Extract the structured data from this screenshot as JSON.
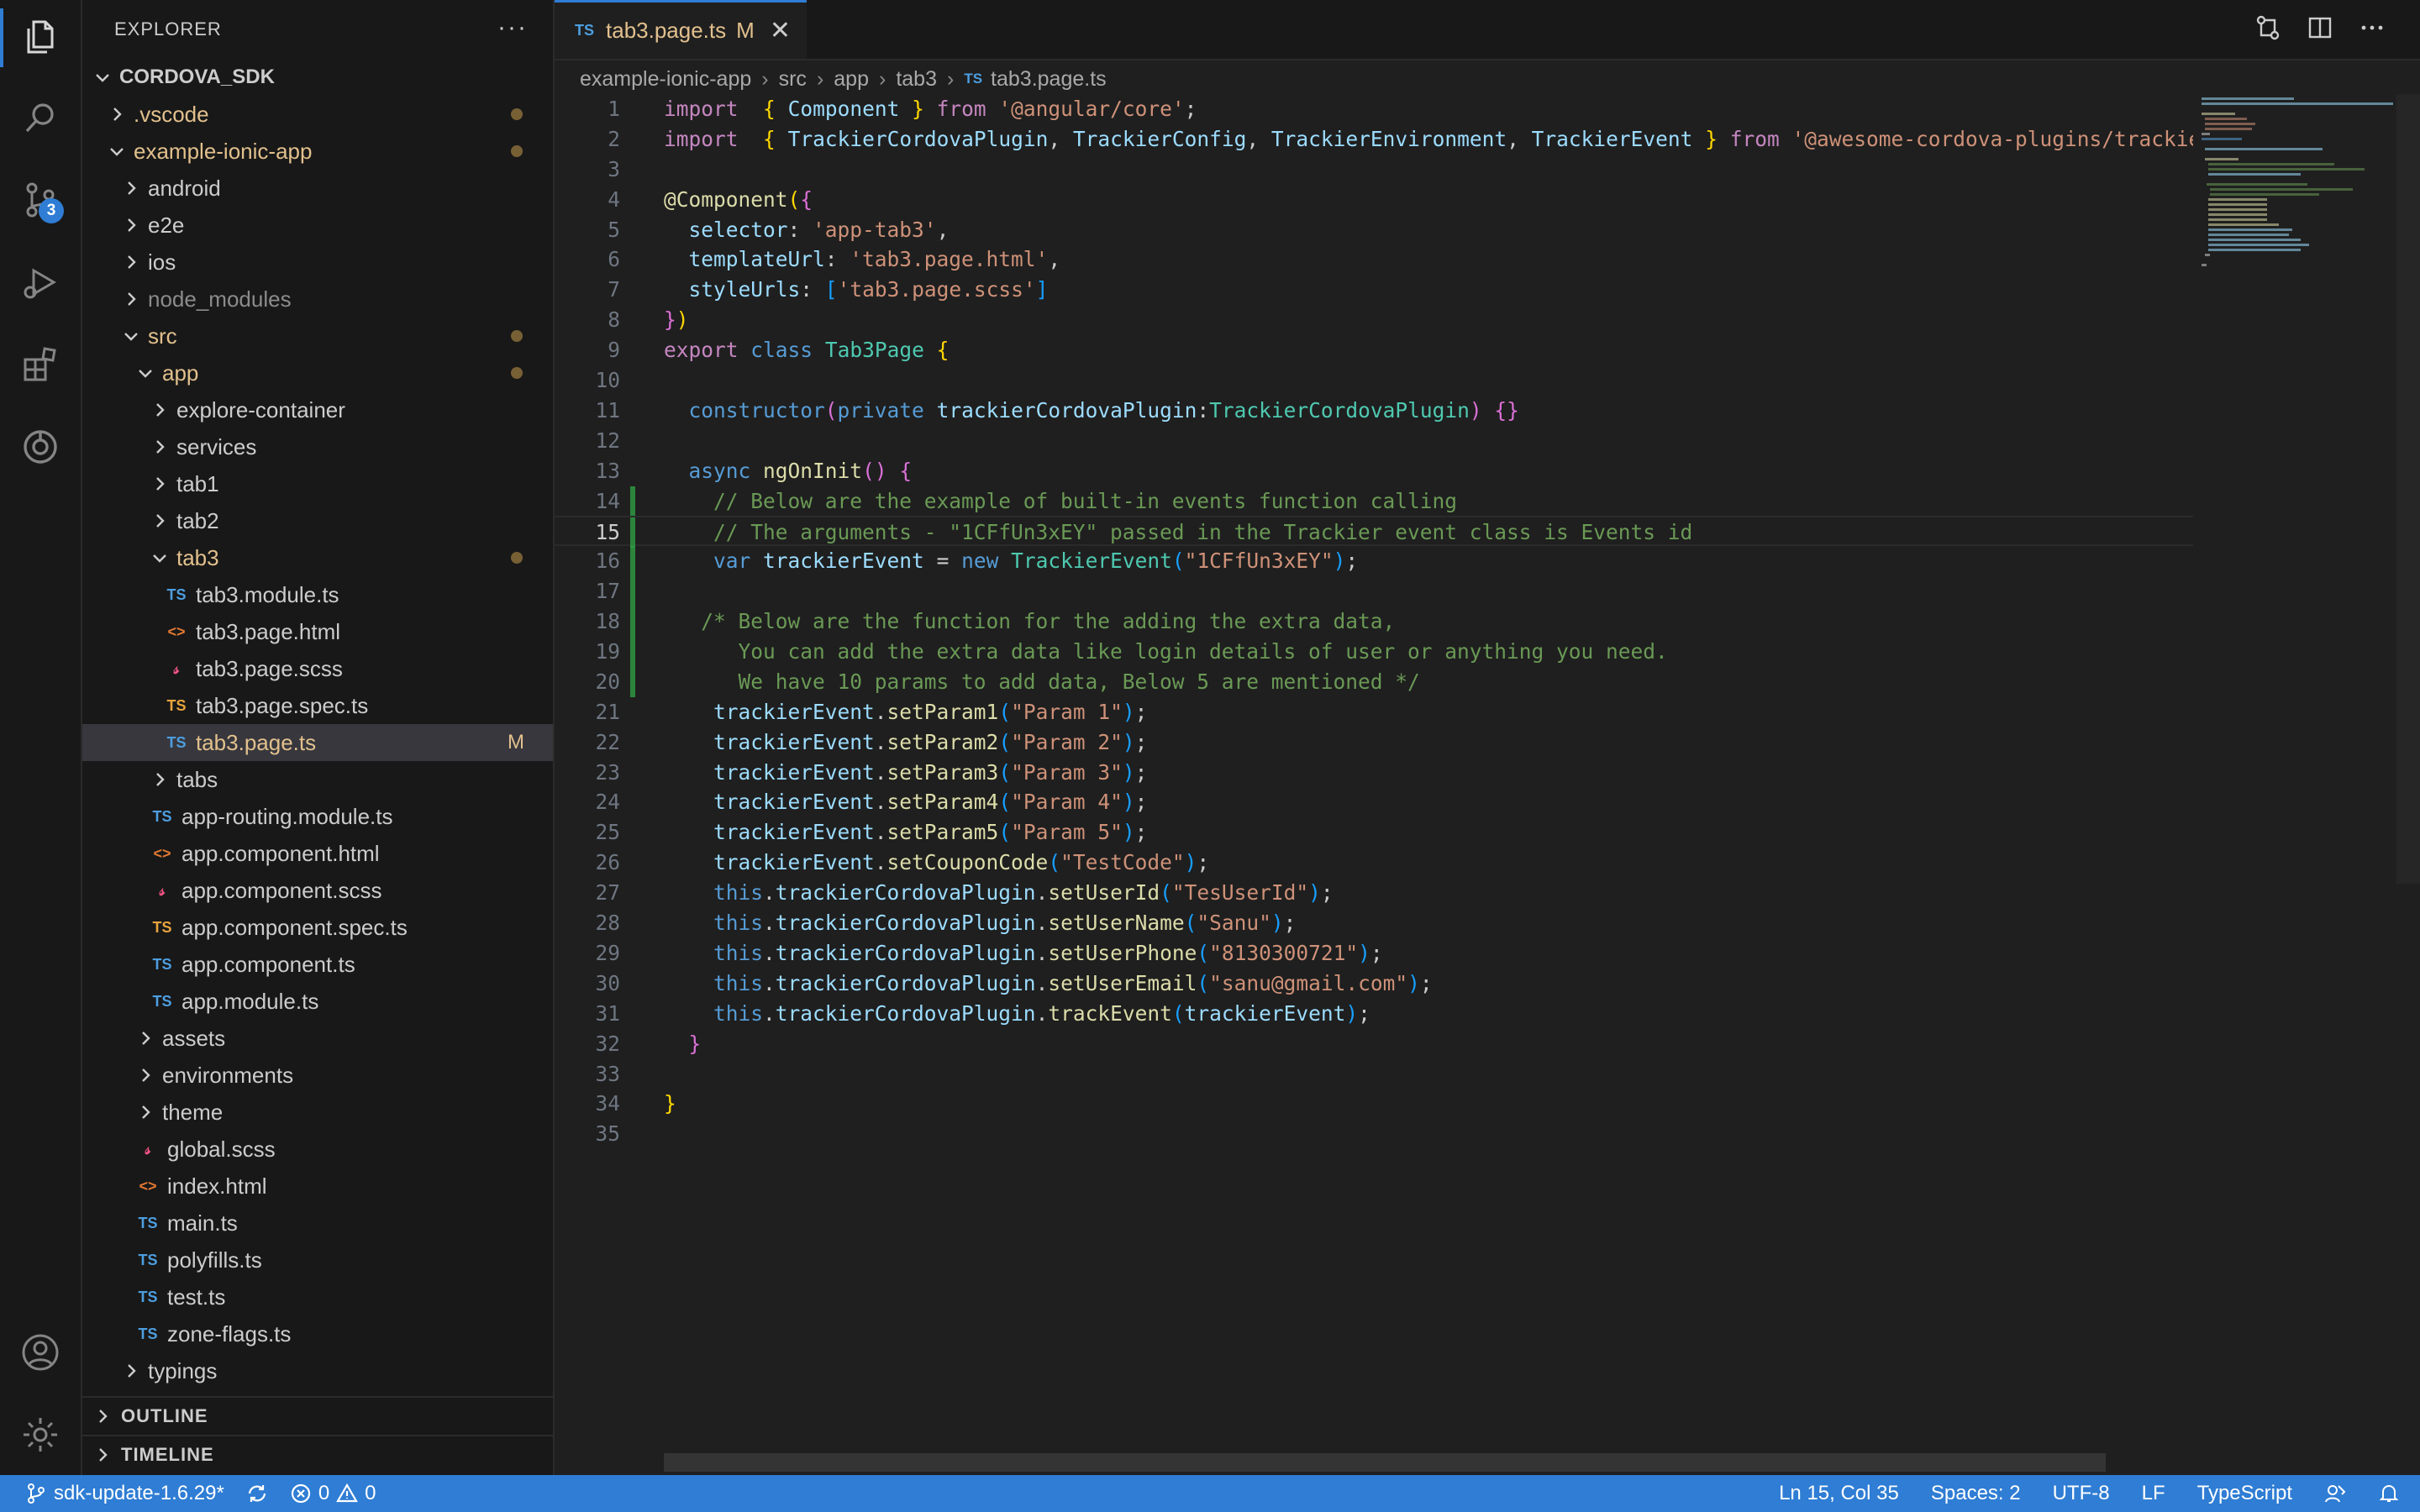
{
  "sidebar": {
    "title": "EXPLORER",
    "more": "···",
    "root": "CORDOVA_SDK",
    "tree": [
      {
        "label": ".vscode",
        "indent": 1,
        "type": "folder",
        "state": "closed",
        "color": "mod",
        "dot": true
      },
      {
        "label": "example-ionic-app",
        "indent": 1,
        "type": "folder",
        "state": "open",
        "color": "mod",
        "dot": true
      },
      {
        "label": "android",
        "indent": 2,
        "type": "folder",
        "state": "closed"
      },
      {
        "label": "e2e",
        "indent": 2,
        "type": "folder",
        "state": "closed"
      },
      {
        "label": "ios",
        "indent": 2,
        "type": "folder",
        "state": "closed"
      },
      {
        "label": "node_modules",
        "indent": 2,
        "type": "folder",
        "state": "closed",
        "color": "muted"
      },
      {
        "label": "src",
        "indent": 2,
        "type": "folder",
        "state": "open",
        "color": "mod",
        "dot": true
      },
      {
        "label": "app",
        "indent": 3,
        "type": "folder",
        "state": "open",
        "color": "mod",
        "dot": true
      },
      {
        "label": "explore-container",
        "indent": 4,
        "type": "folder",
        "state": "closed"
      },
      {
        "label": "services",
        "indent": 4,
        "type": "folder",
        "state": "closed"
      },
      {
        "label": "tab1",
        "indent": 4,
        "type": "folder",
        "state": "closed"
      },
      {
        "label": "tab2",
        "indent": 4,
        "type": "folder",
        "state": "closed"
      },
      {
        "label": "tab3",
        "indent": 4,
        "type": "folder",
        "state": "open",
        "color": "mod",
        "dot": true
      },
      {
        "label": "tab3.module.ts",
        "indent": 5,
        "type": "ts"
      },
      {
        "label": "tab3.page.html",
        "indent": 5,
        "type": "html"
      },
      {
        "label": "tab3.page.scss",
        "indent": 5,
        "type": "scss"
      },
      {
        "label": "tab3.page.spec.ts",
        "indent": 5,
        "type": "spec"
      },
      {
        "label": "tab3.page.ts",
        "indent": 5,
        "type": "ts",
        "color": "mod",
        "selected": true,
        "flag": "M"
      },
      {
        "label": "tabs",
        "indent": 4,
        "type": "folder",
        "state": "closed"
      },
      {
        "label": "app-routing.module.ts",
        "indent": 4,
        "type": "ts"
      },
      {
        "label": "app.component.html",
        "indent": 4,
        "type": "html"
      },
      {
        "label": "app.component.scss",
        "indent": 4,
        "type": "scss"
      },
      {
        "label": "app.component.spec.ts",
        "indent": 4,
        "type": "spec"
      },
      {
        "label": "app.component.ts",
        "indent": 4,
        "type": "ts"
      },
      {
        "label": "app.module.ts",
        "indent": 4,
        "type": "ts"
      },
      {
        "label": "assets",
        "indent": 3,
        "type": "folder",
        "state": "closed"
      },
      {
        "label": "environments",
        "indent": 3,
        "type": "folder",
        "state": "closed"
      },
      {
        "label": "theme",
        "indent": 3,
        "type": "folder",
        "state": "closed"
      },
      {
        "label": "global.scss",
        "indent": 3,
        "type": "scss"
      },
      {
        "label": "index.html",
        "indent": 3,
        "type": "html"
      },
      {
        "label": "main.ts",
        "indent": 3,
        "type": "ts"
      },
      {
        "label": "polyfills.ts",
        "indent": 3,
        "type": "ts"
      },
      {
        "label": "test.ts",
        "indent": 3,
        "type": "ts"
      },
      {
        "label": "zone-flags.ts",
        "indent": 3,
        "type": "ts"
      },
      {
        "label": "typings",
        "indent": 2,
        "type": "folder",
        "state": "closed"
      }
    ],
    "outline": "OUTLINE",
    "timeline": "TIMELINE"
  },
  "activity": {
    "scm_badge": "3"
  },
  "tab": {
    "icon": "TS",
    "label": "tab3.page.ts",
    "flag": "M",
    "close": "✕"
  },
  "breadcrumbs": [
    "example-ionic-app",
    "src",
    "app",
    "tab3",
    "tab3.page.ts"
  ],
  "breadcrumb_icon": "TS",
  "editor": {
    "current_line": 15,
    "modified_lines": [
      14,
      15,
      16,
      17,
      18,
      19,
      20
    ],
    "lines": [
      [
        [
          "k",
          "import"
        ],
        [
          "",
          "  "
        ],
        [
          "y",
          "{"
        ],
        [
          "",
          " "
        ],
        [
          "v",
          "Component"
        ],
        [
          "",
          " "
        ],
        [
          "y",
          "}"
        ],
        [
          "",
          " "
        ],
        [
          "k",
          "from"
        ],
        [
          "",
          " "
        ],
        [
          "s",
          "'@angular/core'"
        ],
        [
          "",
          ";"
        ]
      ],
      [
        [
          "k",
          "import"
        ],
        [
          "",
          "  "
        ],
        [
          "y",
          "{"
        ],
        [
          "",
          " "
        ],
        [
          "v",
          "TrackierCordovaPlugin"
        ],
        [
          "",
          ", "
        ],
        [
          "v",
          "TrackierConfig"
        ],
        [
          "",
          ", "
        ],
        [
          "v",
          "TrackierEnvironment"
        ],
        [
          "",
          ", "
        ],
        [
          "v",
          "TrackierEvent"
        ],
        [
          "",
          " "
        ],
        [
          "y",
          "}"
        ],
        [
          "",
          " "
        ],
        [
          "k",
          "from"
        ],
        [
          "",
          " "
        ],
        [
          "s",
          "'@awesome-cordova-plugins/trackier/ngx';"
        ]
      ],
      [],
      [
        [
          "deco",
          "@Component"
        ],
        [
          "y",
          "("
        ],
        [
          "p",
          "{"
        ]
      ],
      [
        [
          "",
          "  "
        ],
        [
          "v",
          "selector"
        ],
        [
          "",
          ": "
        ],
        [
          "s",
          "'app-tab3'"
        ],
        [
          "",
          ","
        ]
      ],
      [
        [
          "",
          "  "
        ],
        [
          "v",
          "templateUrl"
        ],
        [
          "",
          ": "
        ],
        [
          "s",
          "'tab3.page.html'"
        ],
        [
          "",
          ","
        ]
      ],
      [
        [
          "",
          "  "
        ],
        [
          "v",
          "styleUrls"
        ],
        [
          "",
          ": "
        ],
        [
          "l",
          "["
        ],
        [
          "s",
          "'tab3.page.scss'"
        ],
        [
          "l",
          "]"
        ]
      ],
      [
        [
          "p",
          "}"
        ],
        [
          "y",
          ")"
        ]
      ],
      [
        [
          "k",
          "export"
        ],
        [
          "",
          " "
        ],
        [
          "b",
          "class"
        ],
        [
          "",
          " "
        ],
        [
          "t",
          "Tab3Page"
        ],
        [
          "",
          " "
        ],
        [
          "y",
          "{"
        ]
      ],
      [],
      [
        [
          "",
          "  "
        ],
        [
          "b",
          "constructor"
        ],
        [
          "p",
          "("
        ],
        [
          "b",
          "private"
        ],
        [
          "",
          " "
        ],
        [
          "v",
          "trackierCordovaPlugin"
        ],
        [
          "",
          ":"
        ],
        [
          "t",
          "TrackierCordovaPlugin"
        ],
        [
          "p",
          ")"
        ],
        [
          "",
          " "
        ],
        [
          "p",
          "{}"
        ]
      ],
      [],
      [
        [
          "",
          "  "
        ],
        [
          "b",
          "async"
        ],
        [
          "",
          " "
        ],
        [
          "f",
          "ngOnInit"
        ],
        [
          "p",
          "()"
        ],
        [
          "",
          " "
        ],
        [
          "p",
          "{"
        ]
      ],
      [
        [
          "",
          "    "
        ],
        [
          "c",
          "// Below are the example of built-in events function calling"
        ]
      ],
      [
        [
          "",
          "    "
        ],
        [
          "c",
          "// The arguments - \"1CFfUn3xEY\" passed in the Trackier event class is Events id"
        ]
      ],
      [
        [
          "",
          "    "
        ],
        [
          "b",
          "var"
        ],
        [
          "",
          " "
        ],
        [
          "v",
          "trackierEvent"
        ],
        [
          "",
          " = "
        ],
        [
          "b",
          "new"
        ],
        [
          "",
          " "
        ],
        [
          "t",
          "TrackierEvent"
        ],
        [
          "l",
          "("
        ],
        [
          "s",
          "\"1CFfUn3xEY\""
        ],
        [
          "l",
          ")"
        ],
        [
          "",
          ";"
        ]
      ],
      [],
      [
        [
          "",
          "   "
        ],
        [
          "c",
          "/* Below are the function for the adding the extra data,"
        ]
      ],
      [
        [
          "",
          "      "
        ],
        [
          "c",
          "You can add the extra data like login details of user or anything you need."
        ]
      ],
      [
        [
          "",
          "      "
        ],
        [
          "c",
          "We have 10 params to add data, Below 5 are mentioned */"
        ]
      ],
      [
        [
          "",
          "    "
        ],
        [
          "v",
          "trackierEvent"
        ],
        [
          "",
          "."
        ],
        [
          "f",
          "setParam1"
        ],
        [
          "l",
          "("
        ],
        [
          "s",
          "\"Param 1\""
        ],
        [
          "l",
          ")"
        ],
        [
          "",
          ";"
        ]
      ],
      [
        [
          "",
          "    "
        ],
        [
          "v",
          "trackierEvent"
        ],
        [
          "",
          "."
        ],
        [
          "f",
          "setParam2"
        ],
        [
          "l",
          "("
        ],
        [
          "s",
          "\"Param 2\""
        ],
        [
          "l",
          ")"
        ],
        [
          "",
          ";"
        ]
      ],
      [
        [
          "",
          "    "
        ],
        [
          "v",
          "trackierEvent"
        ],
        [
          "",
          "."
        ],
        [
          "f",
          "setParam3"
        ],
        [
          "l",
          "("
        ],
        [
          "s",
          "\"Param 3\""
        ],
        [
          "l",
          ")"
        ],
        [
          "",
          ";"
        ]
      ],
      [
        [
          "",
          "    "
        ],
        [
          "v",
          "trackierEvent"
        ],
        [
          "",
          "."
        ],
        [
          "f",
          "setParam4"
        ],
        [
          "l",
          "("
        ],
        [
          "s",
          "\"Param 4\""
        ],
        [
          "l",
          ")"
        ],
        [
          "",
          ";"
        ]
      ],
      [
        [
          "",
          "    "
        ],
        [
          "v",
          "trackierEvent"
        ],
        [
          "",
          "."
        ],
        [
          "f",
          "setParam5"
        ],
        [
          "l",
          "("
        ],
        [
          "s",
          "\"Param 5\""
        ],
        [
          "l",
          ")"
        ],
        [
          "",
          ";"
        ]
      ],
      [
        [
          "",
          "    "
        ],
        [
          "v",
          "trackierEvent"
        ],
        [
          "",
          "."
        ],
        [
          "f",
          "setCouponCode"
        ],
        [
          "l",
          "("
        ],
        [
          "s",
          "\"TestCode\""
        ],
        [
          "l",
          ")"
        ],
        [
          "",
          ";"
        ]
      ],
      [
        [
          "",
          "    "
        ],
        [
          "b",
          "this"
        ],
        [
          "",
          "."
        ],
        [
          "v",
          "trackierCordovaPlugin"
        ],
        [
          "",
          "."
        ],
        [
          "f",
          "setUserId"
        ],
        [
          "l",
          "("
        ],
        [
          "s",
          "\"TesUserId\""
        ],
        [
          "l",
          ")"
        ],
        [
          "",
          ";"
        ]
      ],
      [
        [
          "",
          "    "
        ],
        [
          "b",
          "this"
        ],
        [
          "",
          "."
        ],
        [
          "v",
          "trackierCordovaPlugin"
        ],
        [
          "",
          "."
        ],
        [
          "f",
          "setUserName"
        ],
        [
          "l",
          "("
        ],
        [
          "s",
          "\"Sanu\""
        ],
        [
          "l",
          ")"
        ],
        [
          "",
          ";"
        ]
      ],
      [
        [
          "",
          "    "
        ],
        [
          "b",
          "this"
        ],
        [
          "",
          "."
        ],
        [
          "v",
          "trackierCordovaPlugin"
        ],
        [
          "",
          "."
        ],
        [
          "f",
          "setUserPhone"
        ],
        [
          "l",
          "("
        ],
        [
          "s",
          "\"8130300721\""
        ],
        [
          "l",
          ")"
        ],
        [
          "",
          ";"
        ]
      ],
      [
        [
          "",
          "    "
        ],
        [
          "b",
          "this"
        ],
        [
          "",
          "."
        ],
        [
          "v",
          "trackierCordovaPlugin"
        ],
        [
          "",
          "."
        ],
        [
          "f",
          "setUserEmail"
        ],
        [
          "l",
          "("
        ],
        [
          "s",
          "\"sanu@gmail.com\""
        ],
        [
          "l",
          ")"
        ],
        [
          "",
          ";"
        ]
      ],
      [
        [
          "",
          "    "
        ],
        [
          "b",
          "this"
        ],
        [
          "",
          "."
        ],
        [
          "v",
          "trackierCordovaPlugin"
        ],
        [
          "",
          "."
        ],
        [
          "f",
          "trackEvent"
        ],
        [
          "l",
          "("
        ],
        [
          "v",
          "trackierEvent"
        ],
        [
          "l",
          ")"
        ],
        [
          "",
          ";"
        ]
      ],
      [
        [
          "",
          "  "
        ],
        [
          "p",
          "}"
        ]
      ],
      [],
      [
        [
          "y",
          "}"
        ]
      ],
      []
    ]
  },
  "status": {
    "branch": "sdk-update-1.6.29*",
    "errors": "0",
    "warnings": "0",
    "position": "Ln 15, Col 35",
    "spaces": "Spaces: 2",
    "encoding": "UTF-8",
    "eol": "LF",
    "language": "TypeScript"
  },
  "colors": {
    "accent": "#2f7dd4",
    "modified": "#e2c08d",
    "background": "#1f1f1f"
  }
}
